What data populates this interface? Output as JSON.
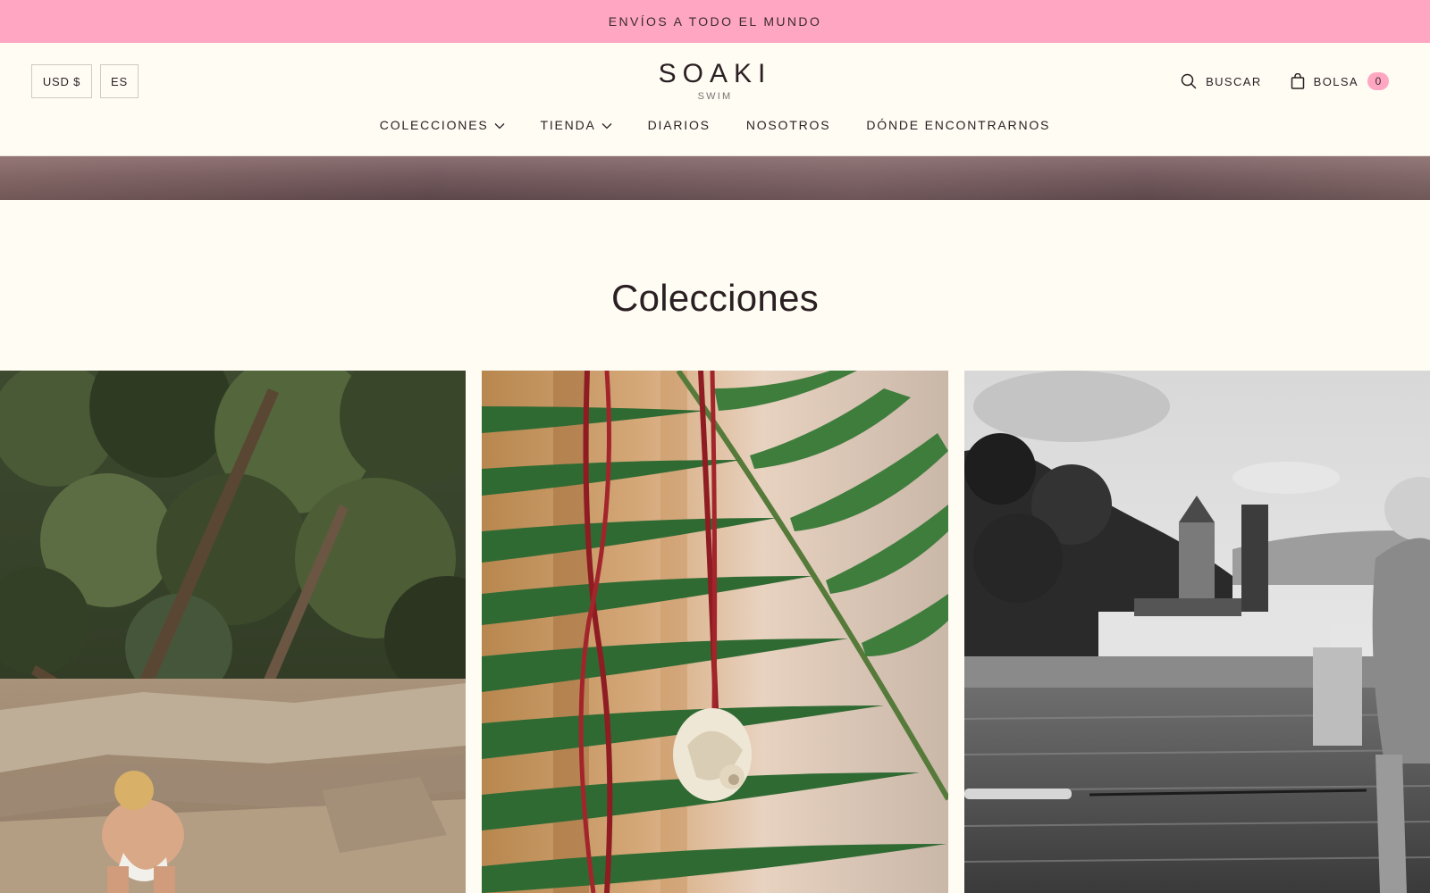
{
  "announcement": {
    "text": "ENVÍOS A TODO EL MUNDO"
  },
  "header": {
    "currency": "USD $",
    "language": "ES",
    "brand": "SOAKI",
    "brand_sub": "SWIM",
    "search_label": "BUSCAR",
    "bag_label": "BOLSA",
    "bag_count": "0",
    "search_icon": "search-icon",
    "bag_icon": "shopping-bag-icon"
  },
  "nav": {
    "items": [
      {
        "label": "COLECCIONES",
        "has_dropdown": true
      },
      {
        "label": "TIENDA",
        "has_dropdown": true
      },
      {
        "label": "DIARIOS",
        "has_dropdown": false
      },
      {
        "label": "NOSOTROS",
        "has_dropdown": false
      },
      {
        "label": "DÓNDE ENCONTRARNOS",
        "has_dropdown": false
      }
    ]
  },
  "section": {
    "title": "Colecciones"
  },
  "colors": {
    "announcement_bg": "#ffa6c2",
    "page_bg": "#fffcf4",
    "text": "#2a1f22",
    "badge_bg": "#ffa6c2"
  }
}
